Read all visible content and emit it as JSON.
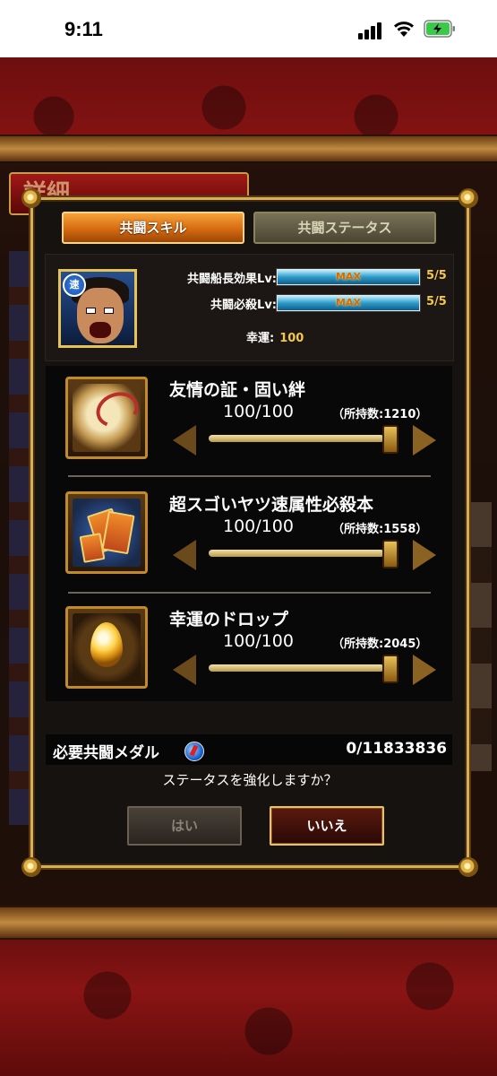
{
  "status_bar": {
    "time": "9:11"
  },
  "background": {
    "title": "詳細"
  },
  "dialog": {
    "tabs": [
      {
        "label": "共闘スキル",
        "active": true
      },
      {
        "label": "共闘ステータス",
        "active": false
      }
    ],
    "member": {
      "type_badge": "速",
      "captain_effect": {
        "label": "共闘船長効果Lv:",
        "bar_text": "MAX",
        "value": "5/5"
      },
      "special": {
        "label": "共闘必殺Lv:",
        "bar_text": "MAX",
        "value": "5/5"
      },
      "luck": {
        "label": "幸運:",
        "value": "100"
      }
    },
    "items": [
      {
        "name": "友情の証・固い絆",
        "amount": "100/100",
        "owned": "（所持数:1210）",
        "icon": "rope-scroll-icon"
      },
      {
        "name": "超スゴいヤツ速属性必殺本",
        "amount": "100/100",
        "owned": "（所持数:1558）",
        "icon": "skill-book-icon"
      },
      {
        "name": "幸運のドロップ",
        "amount": "100/100",
        "owned": "（所持数:2045）",
        "icon": "luck-drop-icon"
      }
    ],
    "medal": {
      "label": "必要共闘メダル",
      "value": "0/11833836",
      "icon": "medal-icon"
    },
    "question": "ステータスを強化しますか？",
    "buttons": {
      "yes": "はい",
      "no": "いいえ"
    }
  },
  "colors": {
    "accent_gold": "#d8ad53",
    "tab_orange": "#d66a10",
    "value_yellow": "#f3c84a",
    "max_text": "#d86a08"
  }
}
